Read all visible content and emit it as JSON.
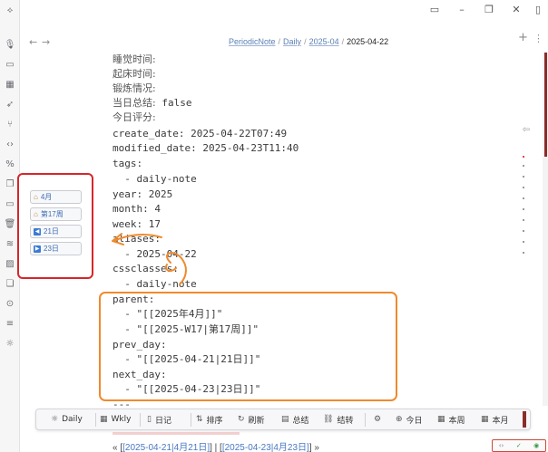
{
  "window": {
    "app_icon": "obsidian-logo-icon",
    "controls": [
      "sidebar-toggle-icon",
      "restore-icon",
      "close-icon",
      "window-control-icon"
    ]
  },
  "breadcrumb": {
    "parts": [
      "PeriodicNote",
      "Daily",
      "2025-04"
    ],
    "current": "2025-04-22",
    "separator": "/"
  },
  "actions": {
    "back": "←",
    "forward": "→",
    "new_tab": "+",
    "more": "⋮"
  },
  "document": {
    "lines": [
      {
        "key": "睡觉时间:",
        "value": ""
      },
      {
        "key": "起床时间:",
        "value": ""
      },
      {
        "key": "锻炼情况:",
        "value": ""
      },
      {
        "key": "当日总结:",
        "value": " false"
      },
      {
        "key": "今日评分:",
        "value": ""
      },
      {
        "key": "create_date:",
        "value": " 2025-04-22T07:49"
      },
      {
        "key": "modified_date:",
        "value": " 2025-04-23T11:40"
      },
      {
        "key": "tags:",
        "value": ""
      },
      {
        "key": "  - daily-note",
        "value": ""
      },
      {
        "key": "year:",
        "value": " 2025"
      },
      {
        "key": "month:",
        "value": " 4"
      },
      {
        "key": "week:",
        "value": " 17"
      },
      {
        "key": "aliases:",
        "value": ""
      },
      {
        "key": "  - 2025-04-22",
        "value": ""
      },
      {
        "key": "cssclasses:",
        "value": ""
      },
      {
        "key": "  - daily-note",
        "value": ""
      },
      {
        "key": "parent:",
        "value": ""
      },
      {
        "key": "  - \"[[2025年4月]]\"",
        "value": ""
      },
      {
        "key": "  - \"[[2025-W17|第17周]]\"",
        "value": ""
      },
      {
        "key": "prev_day:",
        "value": ""
      },
      {
        "key": "  - \"[[2025-04-21|21日]]\"",
        "value": ""
      },
      {
        "key": "next_day:",
        "value": ""
      },
      {
        "key": "  - \"[[2025-04-23|23日]]\"",
        "value": ""
      },
      {
        "key": "---",
        "value": ""
      }
    ]
  },
  "float_panel": {
    "buttons": [
      {
        "icon": "house-icon",
        "label": "4月"
      },
      {
        "icon": "house-icon",
        "label": "第17周"
      },
      {
        "icon": "left-arrow-icon",
        "label": "21日"
      },
      {
        "icon": "right-arrow-icon",
        "label": "23日"
      }
    ]
  },
  "toolbar": {
    "items": [
      {
        "icon": "☼",
        "name": "sun-icon",
        "label": "Daily"
      },
      {
        "icon": "▦",
        "name": "calendar-grid-icon",
        "label": "Wkly"
      },
      {
        "icon": "▯",
        "name": "book-icon",
        "label": "日记"
      },
      {
        "icon": "⇅",
        "name": "sort-icon",
        "label": "排序"
      },
      {
        "icon": "↻",
        "name": "refresh-icon",
        "label": "刷新"
      },
      {
        "icon": "▤",
        "name": "summary-icon",
        "label": "总结"
      },
      {
        "icon": "⛓",
        "name": "chain-icon",
        "label": "结转"
      },
      {
        "icon": "⚙",
        "name": "settings-icon",
        "label": ""
      },
      {
        "icon": "⊕",
        "name": "today-icon",
        "label": "今日"
      },
      {
        "icon": "▦",
        "name": "week-calendar-icon",
        "label": "本周"
      },
      {
        "icon": "▦",
        "name": "month-calendar-icon",
        "label": "本月"
      }
    ]
  },
  "bottom_links": {
    "prefix": "« [",
    "prev": "[2025-04-21|4月21日]",
    "middle": "] | [",
    "next": "[2025-04-23|4月23日]",
    "suffix": "] »"
  },
  "colors": {
    "red_frame": "#d6262b",
    "orange_annotation": "#f08a2c",
    "accent_dark_red": "#8b2c2a",
    "link_blue": "#4a78c2"
  }
}
